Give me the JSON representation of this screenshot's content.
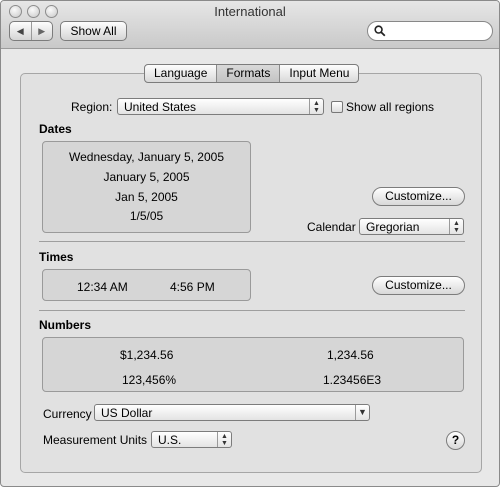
{
  "window": {
    "title": "International"
  },
  "toolbar": {
    "back_glyph": "◀",
    "forward_glyph": "▶",
    "show_all_label": "Show All",
    "search_placeholder": ""
  },
  "tabs": [
    {
      "label": "Language",
      "selected": false
    },
    {
      "label": "Formats",
      "selected": true
    },
    {
      "label": "Input Menu",
      "selected": false
    }
  ],
  "region": {
    "label": "Region:",
    "value": "United States",
    "show_all_label": "Show all regions",
    "show_all_checked": false
  },
  "dates": {
    "heading": "Dates",
    "examples": [
      "Wednesday, January 5, 2005",
      "January 5, 2005",
      "Jan 5, 2005",
      "1/5/05"
    ],
    "customize_label": "Customize...",
    "calendar_label": "Calendar",
    "calendar_value": "Gregorian"
  },
  "times": {
    "heading": "Times",
    "example_am": "12:34 AM",
    "example_pm": "4:56 PM",
    "customize_label": "Customize..."
  },
  "numbers": {
    "heading": "Numbers",
    "currency_example": "$1,234.56",
    "plain_example": "1,234.56",
    "percent_example": "123,456%",
    "scientific_example": "1.23456E3"
  },
  "currency": {
    "label": "Currency",
    "value": "US Dollar"
  },
  "measurement": {
    "label": "Measurement Units",
    "value": "U.S."
  },
  "help": {
    "glyph": "?"
  }
}
